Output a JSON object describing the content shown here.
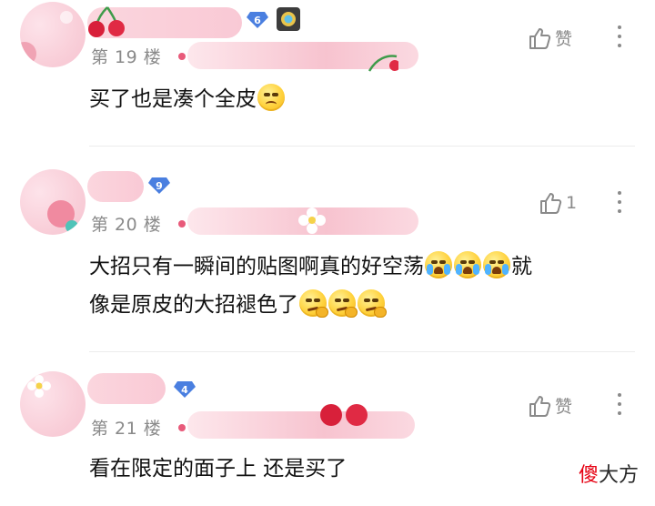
{
  "comments": [
    {
      "level": "6",
      "floor": "第 19 楼",
      "like_label": "赞",
      "text": "买了也是凑个全皮",
      "emojis": [
        "sad"
      ]
    },
    {
      "level": "9",
      "floor": "第 20 楼",
      "like_label": "1",
      "text_line1": "大招只有一瞬间的贴图啊真的好空荡",
      "text_line1_tail": "就",
      "text_line2": "像是原皮的大招褪色了",
      "emojis_line1": [
        "cry",
        "cry",
        "cry"
      ],
      "emojis_line2": [
        "smirk",
        "smirk",
        "smirk"
      ]
    },
    {
      "level": "4",
      "floor": "第 21 楼",
      "like_label": "赞",
      "text": "看在限定的面子上 还是买了"
    }
  ],
  "watermark": {
    "red": "傻",
    "rest": "大方"
  },
  "colors": {
    "level_badge": "#4a7fe0",
    "floor_dot": "#e85a7a",
    "name_blur": "#f9c9d5"
  },
  "icons": [
    "thumb-up-icon",
    "more-vertical-icon",
    "gem-badge-icon"
  ]
}
